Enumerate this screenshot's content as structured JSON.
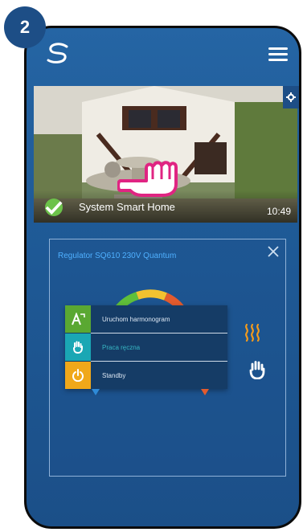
{
  "step": {
    "number": "2"
  },
  "header": {
    "logo_icon": "smart-home-s-logo-icon",
    "menu_icon": "hamburger-menu-icon"
  },
  "home_card": {
    "title": "System Smart Home",
    "time": "10:49",
    "status_icon": "check-icon",
    "settings_icon": "gear-icon"
  },
  "device_panel": {
    "title": "Regulator SQ610 230V Quantum",
    "close_icon": "close-icon",
    "menu": {
      "items": [
        {
          "label": "Uruchom harmonogram",
          "icon": "schedule-a-icon",
          "color": "#5aa832"
        },
        {
          "label": "Praca ręczna",
          "icon": "hand-icon",
          "color": "#1aa7b4"
        },
        {
          "label": "Standby",
          "icon": "power-icon",
          "color": "#f0a81a"
        }
      ]
    },
    "side_icons": [
      {
        "icon": "heating-waves-icon",
        "color": "#f39b1c"
      },
      {
        "icon": "hand-icon",
        "color": "#ffffff"
      }
    ],
    "arc_colors": [
      "#5fbf3a",
      "#f2c230",
      "#e25b2e"
    ]
  },
  "pointer": {
    "icon": "tap-hand-pointer-icon",
    "color": "#e02482"
  }
}
